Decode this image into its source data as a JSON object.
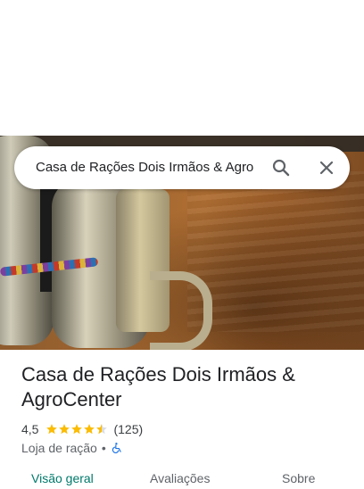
{
  "search": {
    "query": "Casa de Rações Dois Irmãos & Agro"
  },
  "place": {
    "name": "Casa de Rações Dois Irmãos & AgroCenter",
    "rating": "4,5",
    "rating_value": 4.5,
    "reviews": "(125)",
    "category": "Loja de ração",
    "separator": "•"
  },
  "tabs": [
    {
      "label": "Visão geral"
    },
    {
      "label": "Avaliações"
    },
    {
      "label": "Sobre"
    }
  ],
  "colors": {
    "accent": "#00796b",
    "star": "#fbbc04",
    "wheelchair": "#1a73e8"
  },
  "icons": {
    "search": "search-icon",
    "close": "close-icon",
    "accessibility": "wheelchair-icon"
  }
}
